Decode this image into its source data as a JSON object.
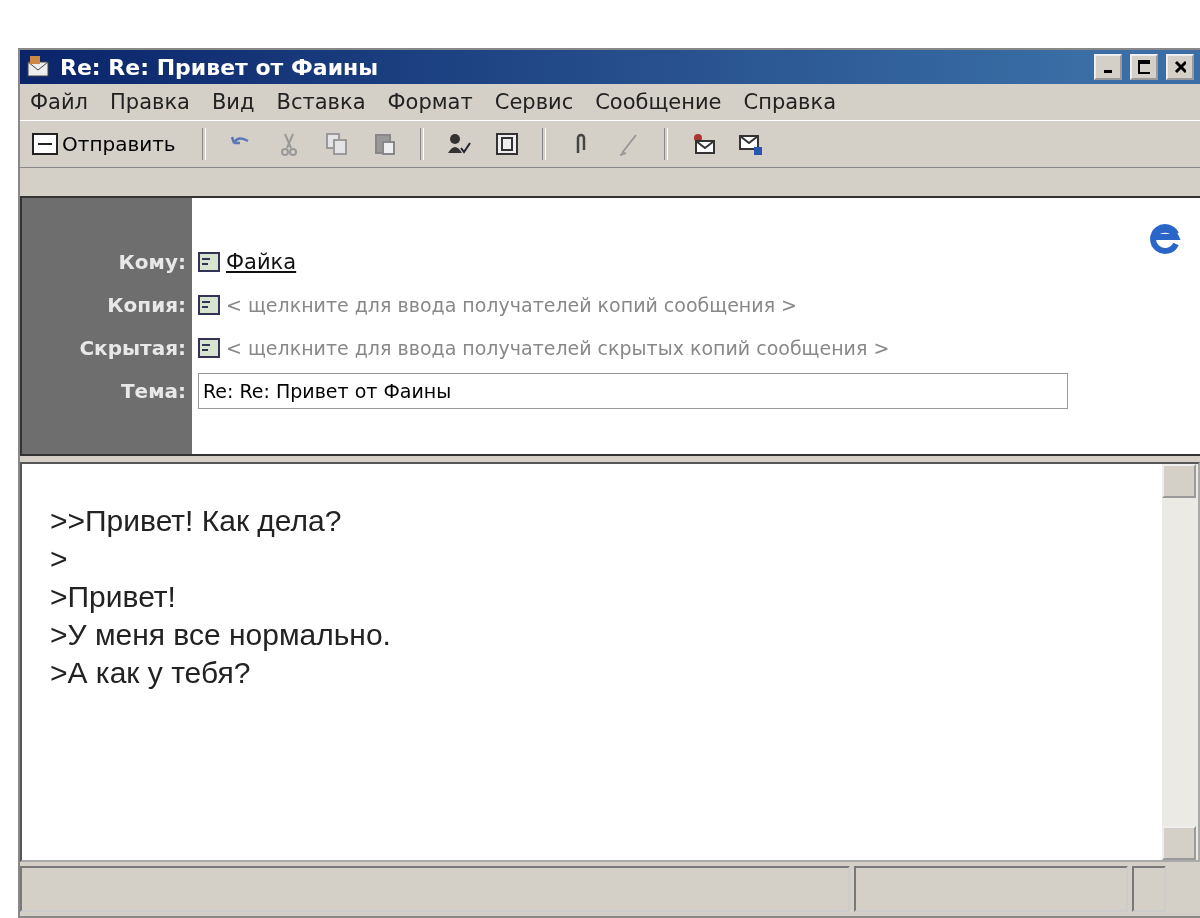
{
  "window": {
    "title": "Re: Re: Привет от Фаины"
  },
  "menu": [
    "Файл",
    "Правка",
    "Вид",
    "Вставка",
    "Формат",
    "Сервис",
    "Сообщение",
    "Справка"
  ],
  "toolbar": [
    {
      "kind": "send",
      "label": "Отправить"
    },
    {
      "kind": "separator"
    },
    {
      "kind": "undo"
    },
    {
      "kind": "cut"
    },
    {
      "kind": "copy"
    },
    {
      "kind": "paste"
    },
    {
      "kind": "separator"
    },
    {
      "kind": "check-names"
    },
    {
      "kind": "address-book"
    },
    {
      "kind": "separator"
    },
    {
      "kind": "attach"
    },
    {
      "kind": "sign"
    },
    {
      "kind": "separator"
    },
    {
      "kind": "signed-mail"
    },
    {
      "kind": "encrypted-mail"
    }
  ],
  "header": {
    "fields": [
      {
        "kind": "recipient",
        "label": "Кому:",
        "value": "Файка"
      },
      {
        "kind": "hint",
        "label": "Копия:",
        "placeholder": "< щелкните для ввода получателей копий сообщения >"
      },
      {
        "kind": "hint",
        "label": "Скрытая:",
        "placeholder": "< щелкните для ввода получателей скрытых копий сообщения >"
      },
      {
        "kind": "input",
        "label": "Тема:",
        "value": "Re: Re: Привет от Фаины"
      }
    ]
  },
  "body": {
    "lines": [
      ">>Привет! Как дела?",
      ">",
      ">Привет!",
      ">У меня все нормально.",
      ">А как у тебя?"
    ]
  }
}
